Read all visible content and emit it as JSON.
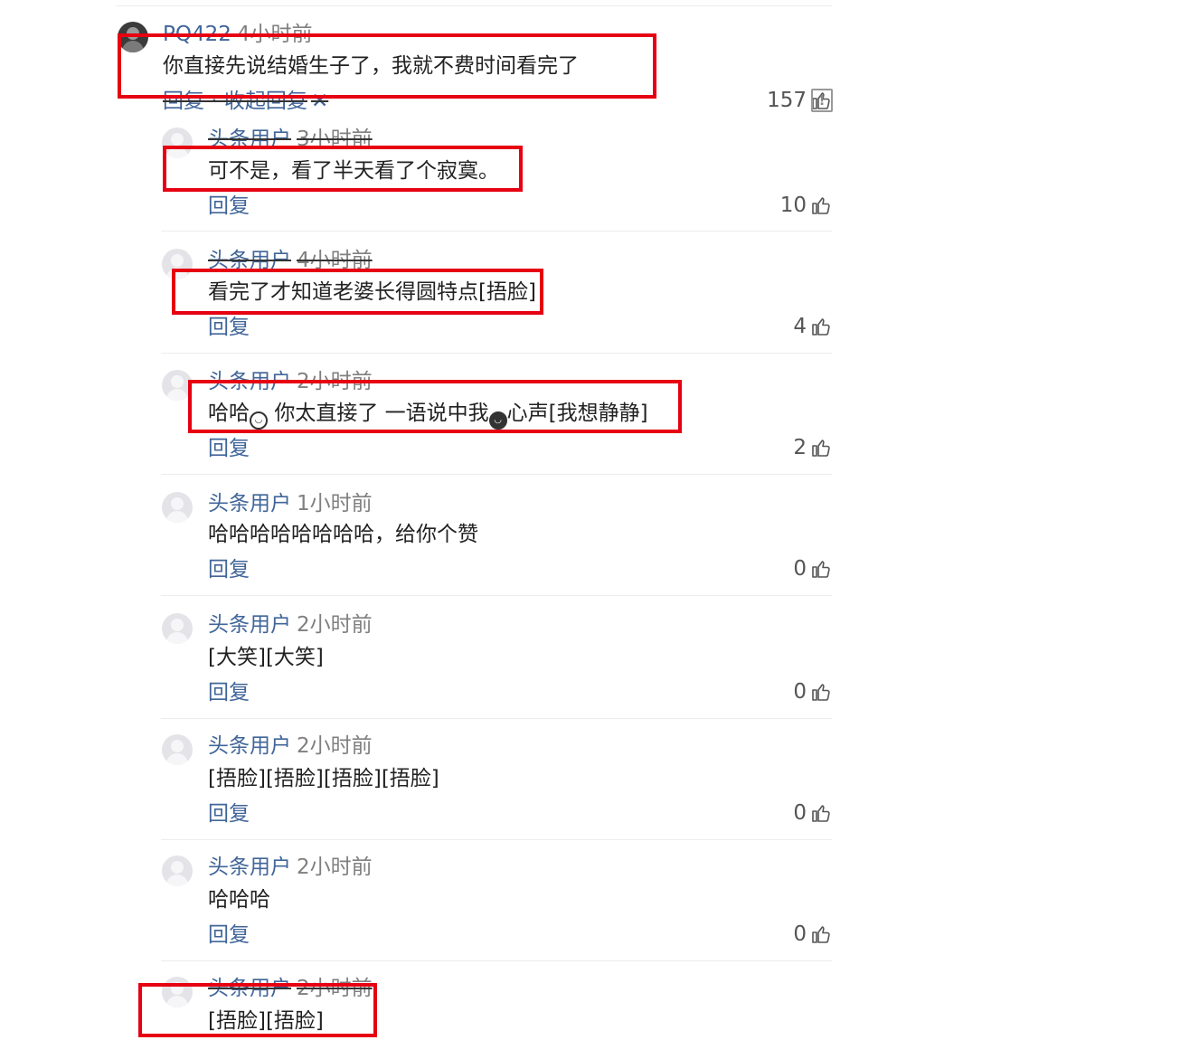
{
  "accent_red": "#e60012",
  "link_blue": "#406599",
  "main_comment": {
    "user": "PQ422",
    "time": "4小时前",
    "text": "你直接先说结婚生子了，我就不费时间看完了",
    "reply_label": "回复 · 收起回复",
    "collapse_icon": "close-x-icon",
    "likes": "157",
    "report_icon": "report-icon"
  },
  "replies": [
    {
      "user": "头条用户",
      "time": "3小时前",
      "text": "可不是，看了半天看了个寂寞。",
      "reply_label": "回复",
      "likes": "10"
    },
    {
      "user": "头条用户",
      "time": "4小时前",
      "text": "看完了才知道老婆长得圆特点[捂脸]",
      "reply_label": "回复",
      "likes": "4"
    },
    {
      "user": "头条用户",
      "time": "2小时前",
      "text_parts": [
        "哈哈",
        "你太直接了 一语说中我",
        "心声[我想静静]"
      ],
      "reply_label": "回复",
      "likes": "2"
    },
    {
      "user": "头条用户",
      "time": "1小时前",
      "text": "哈哈哈哈哈哈哈哈，给你个赞",
      "reply_label": "回复",
      "likes": "0"
    },
    {
      "user": "头条用户",
      "time": "2小时前",
      "text": "[大笑][大笑]",
      "reply_label": "回复",
      "likes": "0"
    },
    {
      "user": "头条用户",
      "time": "2小时前",
      "text": "[捂脸][捂脸][捂脸][捂脸]",
      "reply_label": "回复",
      "likes": "0"
    },
    {
      "user": "头条用户",
      "time": "2小时前",
      "text": "哈哈哈",
      "reply_label": "回复",
      "likes": "0"
    },
    {
      "user": "头条用户",
      "time": "2小时前",
      "text": "[捂脸][捂脸]"
    }
  ]
}
